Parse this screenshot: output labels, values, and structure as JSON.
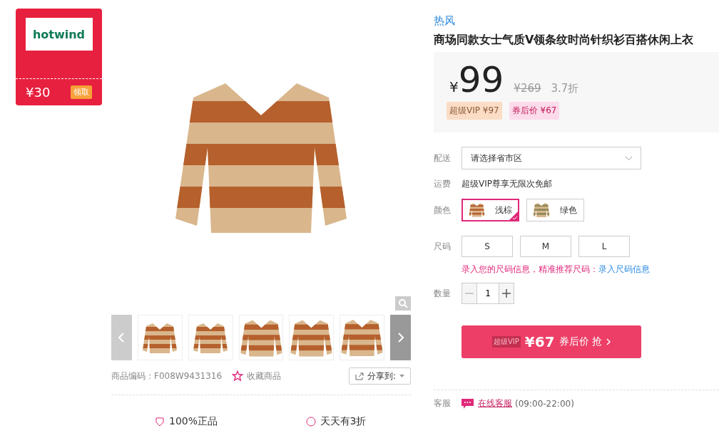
{
  "coupon": {
    "logo": "hotwind",
    "amount": "¥30",
    "action": "领取"
  },
  "gallery": {
    "thumbnails": [
      {
        "kind": "front"
      },
      {
        "kind": "back"
      },
      {
        "kind": "collar"
      },
      {
        "kind": "sleeve"
      },
      {
        "kind": "knit"
      }
    ],
    "product_code": "商品编码：F008W9431316",
    "favorite": "收藏商品",
    "share": "分享到:",
    "guarantees": [
      "100%正品",
      "天天有3折"
    ]
  },
  "product": {
    "brand": "热风",
    "title": "商场同款女士气质V领条纹时尚针织衫百搭休闲上衣",
    "price": {
      "currency": "¥",
      "amount": "99",
      "original": "¥269",
      "discount": "3.7折"
    },
    "tags": [
      {
        "kind": "vip",
        "text": "超级VIP ¥97"
      },
      {
        "kind": "coupon",
        "text": "券后价 ¥67"
      }
    ],
    "delivery": {
      "label": "配送",
      "value": "请选择省市区"
    },
    "shipping": {
      "label": "运费",
      "value": "超级VIP尊享无限次免邮"
    },
    "color": {
      "label": "颜色",
      "options": [
        {
          "label": "浅棕",
          "selected": true
        },
        {
          "label": "绿色",
          "selected": false
        }
      ]
    },
    "size": {
      "label": "尺码",
      "options": [
        {
          "label": "S",
          "selected": false
        },
        {
          "label": "M",
          "selected": false
        },
        {
          "label": "L",
          "selected": false
        }
      ],
      "hint": "录入您的尺码信息，精准推荐尺码：",
      "hint_link": "录入尺码信息"
    },
    "quantity": {
      "label": "数量",
      "value": "1",
      "minus_disabled": true
    },
    "buy": {
      "badge": "超级VIP",
      "price": "¥67",
      "text": "券后价 抢"
    },
    "service": {
      "label": "客服",
      "link": "在线客服",
      "hours": "(09:00-22:00)"
    }
  }
}
